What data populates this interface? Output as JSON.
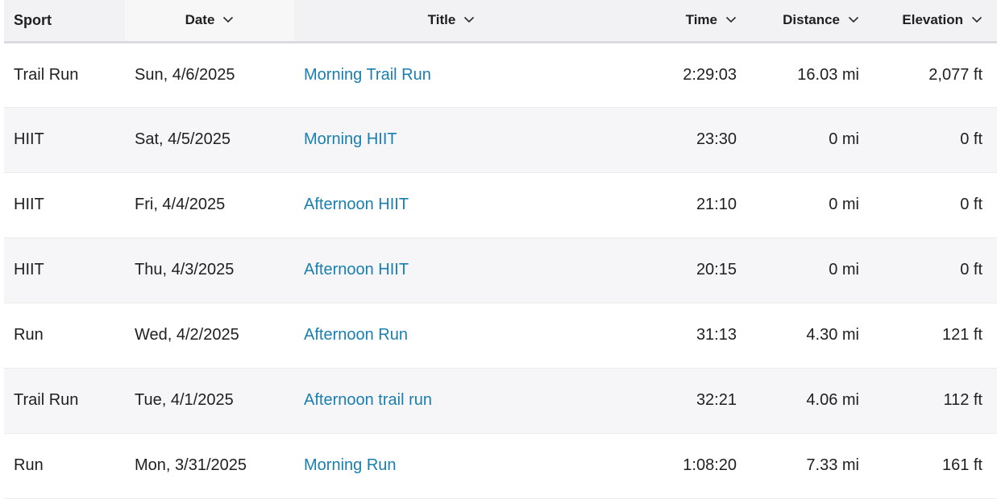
{
  "headers": {
    "sport": "Sport",
    "date": "Date",
    "title": "Title",
    "time": "Time",
    "distance": "Distance",
    "elevation": "Elevation"
  },
  "colors": {
    "link": "#1a7fae",
    "header_bg": "#f2f2f4",
    "row_alt_bg": "#f6f6f8"
  },
  "rows": [
    {
      "sport": "Trail Run",
      "date": "Sun, 4/6/2025",
      "title": "Morning Trail Run",
      "time": "2:29:03",
      "distance": "16.03 mi",
      "elevation": "2,077 ft"
    },
    {
      "sport": "HIIT",
      "date": "Sat, 4/5/2025",
      "title": "Morning HIIT",
      "time": "23:30",
      "distance": "0 mi",
      "elevation": "0 ft"
    },
    {
      "sport": "HIIT",
      "date": "Fri, 4/4/2025",
      "title": "Afternoon HIIT",
      "time": "21:10",
      "distance": "0 mi",
      "elevation": "0 ft"
    },
    {
      "sport": "HIIT",
      "date": "Thu, 4/3/2025",
      "title": "Afternoon HIIT",
      "time": "20:15",
      "distance": "0 mi",
      "elevation": "0 ft"
    },
    {
      "sport": "Run",
      "date": "Wed, 4/2/2025",
      "title": "Afternoon Run",
      "time": "31:13",
      "distance": "4.30 mi",
      "elevation": "121 ft"
    },
    {
      "sport": "Trail Run",
      "date": "Tue, 4/1/2025",
      "title": "Afternoon trail run",
      "time": "32:21",
      "distance": "4.06 mi",
      "elevation": "112 ft"
    },
    {
      "sport": "Run",
      "date": "Mon, 3/31/2025",
      "title": "Morning Run",
      "time": "1:08:20",
      "distance": "7.33 mi",
      "elevation": "161 ft"
    }
  ]
}
